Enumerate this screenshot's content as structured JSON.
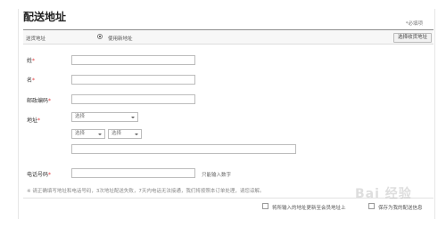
{
  "header": {
    "title": "配送地址",
    "required_note": "*必填项"
  },
  "address_bar": {
    "label": "送货地址",
    "option_label": "使用新地址",
    "existing_button": "选择收货地址"
  },
  "form": {
    "last_name_label": "姓",
    "first_name_label": "名",
    "postcode_label": "邮政编码",
    "address_label": "地址",
    "phone_label": "电话号码",
    "required_star": "*",
    "province_select": "选择",
    "city_select": "选择",
    "district_select": "选择",
    "phone_hint": "只能输入数字"
  },
  "notice": "※ 请正确填写地址和电话号码，3次地址配送失败，7天内电话无法接通，我们将按照本订单处理，请您谅解。",
  "options": {
    "update_profile": "将所输入的地址更新至会员地址上",
    "save_address": "保存为我的配送信息"
  },
  "watermark": "Bai 经验"
}
